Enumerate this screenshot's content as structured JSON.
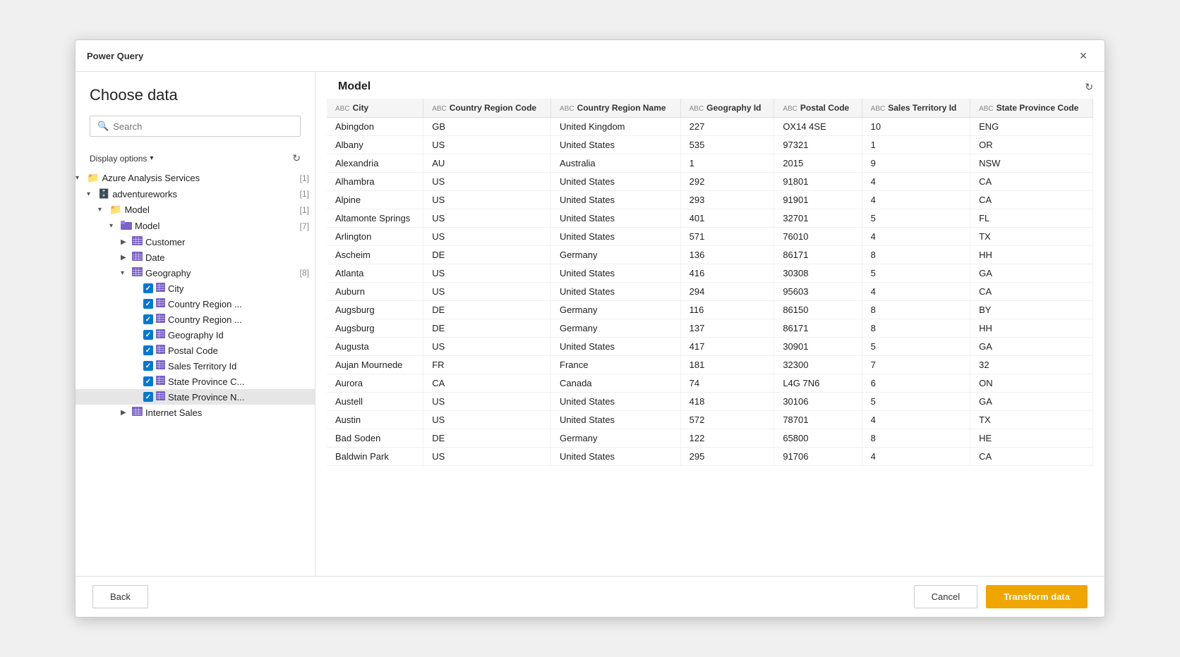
{
  "window": {
    "title": "Power Query",
    "close_label": "×"
  },
  "left_panel": {
    "heading": "Choose data",
    "search_placeholder": "Search",
    "display_options_label": "Display options",
    "refresh_icon": "↻",
    "tree": [
      {
        "id": "azure",
        "level": 0,
        "expanded": true,
        "chevron": "▾",
        "icon_type": "folder-yellow",
        "label": "Azure Analysis Services",
        "count": "[1]"
      },
      {
        "id": "adventureworks",
        "level": 1,
        "expanded": true,
        "chevron": "▾",
        "icon_type": "db",
        "label": "adventureworks",
        "count": "[1]"
      },
      {
        "id": "model-folder",
        "level": 2,
        "expanded": true,
        "chevron": "▾",
        "icon_type": "folder-yellow",
        "label": "Model",
        "count": "[1]"
      },
      {
        "id": "model-item",
        "level": 3,
        "expanded": true,
        "chevron": "▾",
        "icon_type": "folder-purple",
        "label": "Model",
        "count": "[7]"
      },
      {
        "id": "customer",
        "level": 4,
        "expanded": false,
        "chevron": "▶",
        "icon_type": "table",
        "label": "Customer",
        "count": ""
      },
      {
        "id": "date",
        "level": 4,
        "expanded": false,
        "chevron": "▶",
        "icon_type": "table",
        "label": "Date",
        "count": ""
      },
      {
        "id": "geography",
        "level": 4,
        "expanded": true,
        "chevron": "▾",
        "icon_type": "table",
        "label": "Geography",
        "count": "[8]"
      },
      {
        "id": "city",
        "level": 5,
        "expanded": false,
        "chevron": "",
        "icon_type": "col-checked",
        "label": "City",
        "count": ""
      },
      {
        "id": "country-region-code",
        "level": 5,
        "expanded": false,
        "chevron": "",
        "icon_type": "col-checked",
        "label": "Country Region ...",
        "count": ""
      },
      {
        "id": "country-region-name",
        "level": 5,
        "expanded": false,
        "chevron": "",
        "icon_type": "col-checked",
        "label": "Country Region ...",
        "count": ""
      },
      {
        "id": "geography-id",
        "level": 5,
        "expanded": false,
        "chevron": "",
        "icon_type": "col-checked",
        "label": "Geography Id",
        "count": ""
      },
      {
        "id": "postal-code",
        "level": 5,
        "expanded": false,
        "chevron": "",
        "icon_type": "col-checked",
        "label": "Postal Code",
        "count": ""
      },
      {
        "id": "sales-territory-id",
        "level": 5,
        "expanded": false,
        "chevron": "",
        "icon_type": "col-checked",
        "label": "Sales Territory Id",
        "count": ""
      },
      {
        "id": "state-province-c",
        "level": 5,
        "expanded": false,
        "chevron": "",
        "icon_type": "col-checked",
        "label": "State Province C...",
        "count": ""
      },
      {
        "id": "state-province-n",
        "level": 5,
        "expanded": false,
        "chevron": "",
        "icon_type": "col-checked",
        "label": "State Province N...",
        "count": "",
        "selected": true
      },
      {
        "id": "internet-sales",
        "level": 4,
        "expanded": false,
        "chevron": "▶",
        "icon_type": "table",
        "label": "Internet Sales",
        "count": ""
      }
    ]
  },
  "right_panel": {
    "title": "Model",
    "refresh_icon": "↻",
    "columns": [
      {
        "type_label": "ABC",
        "name": "City"
      },
      {
        "type_label": "ABC",
        "name": "Country Region Code"
      },
      {
        "type_label": "ABC",
        "name": "Country Region Name"
      },
      {
        "type_label": "ABC",
        "name": "Geography Id"
      },
      {
        "type_label": "ABC",
        "name": "Postal Code"
      },
      {
        "type_label": "ABC",
        "name": "Sales Territory Id"
      },
      {
        "type_label": "ABC",
        "name": "State Province Code"
      }
    ],
    "rows": [
      [
        "Abingdon",
        "GB",
        "United Kingdom",
        "227",
        "OX14 4SE",
        "10",
        "ENG"
      ],
      [
        "Albany",
        "US",
        "United States",
        "535",
        "97321",
        "1",
        "OR"
      ],
      [
        "Alexandria",
        "AU",
        "Australia",
        "1",
        "2015",
        "9",
        "NSW"
      ],
      [
        "Alhambra",
        "US",
        "United States",
        "292",
        "91801",
        "4",
        "CA"
      ],
      [
        "Alpine",
        "US",
        "United States",
        "293",
        "91901",
        "4",
        "CA"
      ],
      [
        "Altamonte Springs",
        "US",
        "United States",
        "401",
        "32701",
        "5",
        "FL"
      ],
      [
        "Arlington",
        "US",
        "United States",
        "571",
        "76010",
        "4",
        "TX"
      ],
      [
        "Ascheim",
        "DE",
        "Germany",
        "136",
        "86171",
        "8",
        "HH"
      ],
      [
        "Atlanta",
        "US",
        "United States",
        "416",
        "30308",
        "5",
        "GA"
      ],
      [
        "Auburn",
        "US",
        "United States",
        "294",
        "95603",
        "4",
        "CA"
      ],
      [
        "Augsburg",
        "DE",
        "Germany",
        "116",
        "86150",
        "8",
        "BY"
      ],
      [
        "Augsburg",
        "DE",
        "Germany",
        "137",
        "86171",
        "8",
        "HH"
      ],
      [
        "Augusta",
        "US",
        "United States",
        "417",
        "30901",
        "5",
        "GA"
      ],
      [
        "Aujan Mournede",
        "FR",
        "France",
        "181",
        "32300",
        "7",
        "32"
      ],
      [
        "Aurora",
        "CA",
        "Canada",
        "74",
        "L4G 7N6",
        "6",
        "ON"
      ],
      [
        "Austell",
        "US",
        "United States",
        "418",
        "30106",
        "5",
        "GA"
      ],
      [
        "Austin",
        "US",
        "United States",
        "572",
        "78701",
        "4",
        "TX"
      ],
      [
        "Bad Soden",
        "DE",
        "Germany",
        "122",
        "65800",
        "8",
        "HE"
      ],
      [
        "Baldwin Park",
        "US",
        "United States",
        "295",
        "91706",
        "4",
        "CA"
      ]
    ]
  },
  "footer": {
    "back_label": "Back",
    "cancel_label": "Cancel",
    "transform_label": "Transform data"
  }
}
